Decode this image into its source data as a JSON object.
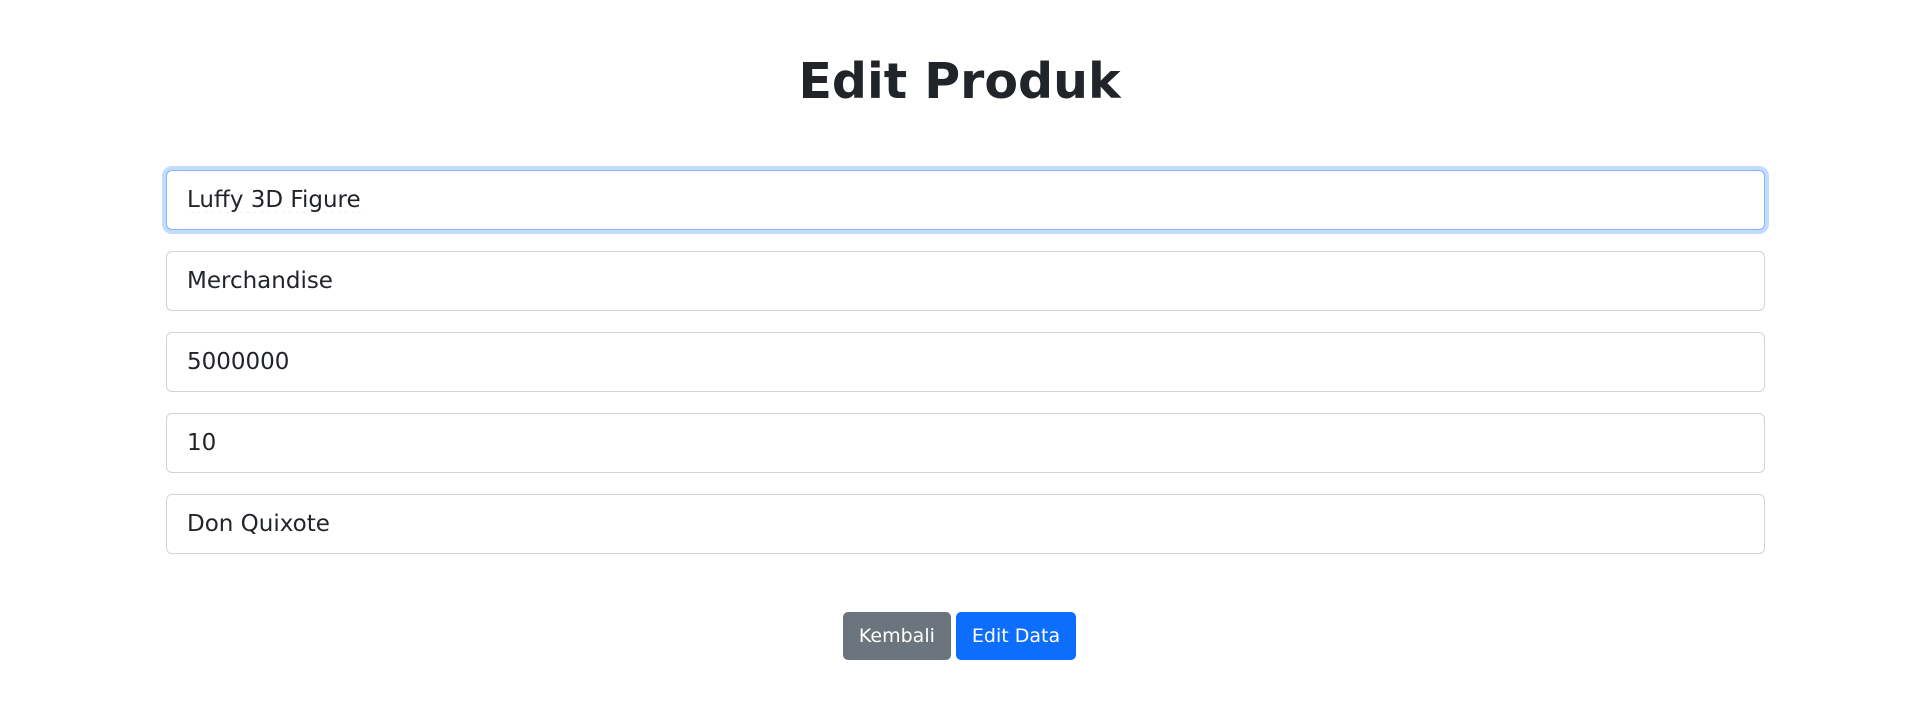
{
  "page": {
    "title": "Edit Produk"
  },
  "form": {
    "fields": [
      {
        "value": "Luffy 3D Figure"
      },
      {
        "value": "Merchandise"
      },
      {
        "value": "5000000"
      },
      {
        "value": "10"
      },
      {
        "value": "Don Quixote"
      }
    ]
  },
  "actions": {
    "back_label": "Kembali",
    "submit_label": "Edit Data"
  },
  "colors": {
    "primary": "#0d6efd",
    "secondary": "#6c757d",
    "focus_border": "#86b7fe",
    "text": "#212529"
  }
}
